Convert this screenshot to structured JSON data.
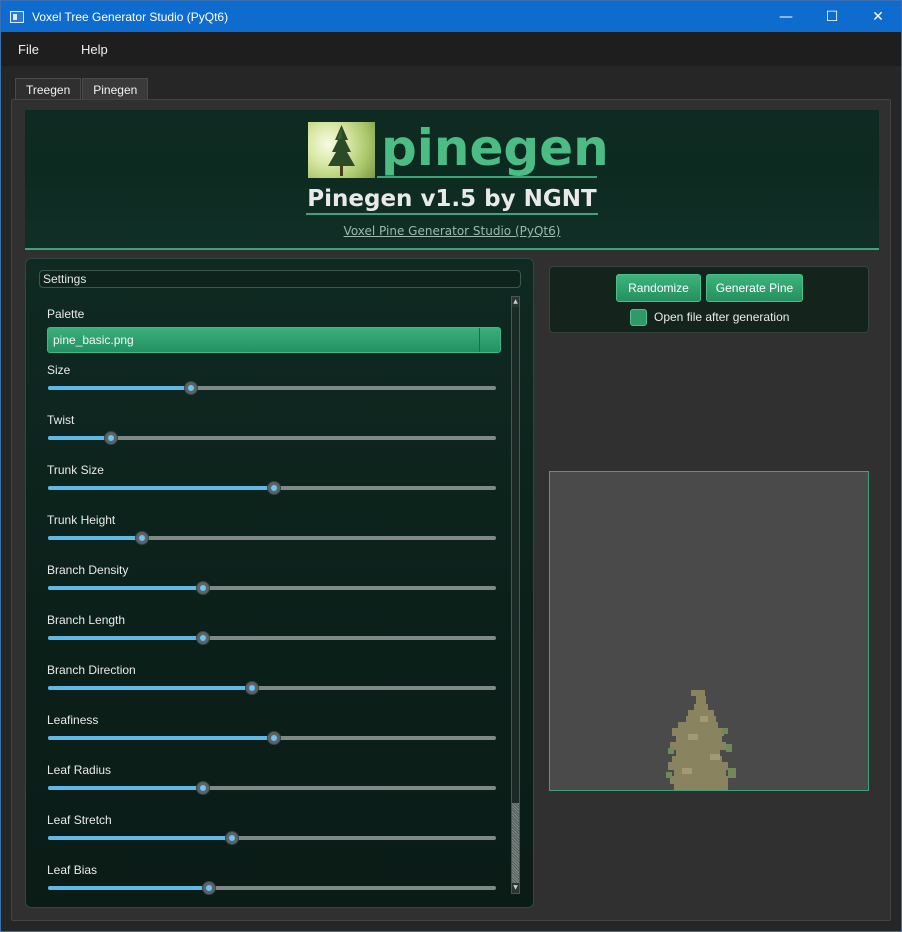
{
  "window": {
    "title": "Voxel Tree Generator Studio (PyQt6)",
    "minimize": "—",
    "maximize": "☐",
    "close": "✕"
  },
  "menu": {
    "file": "File",
    "help": "Help"
  },
  "tabs": [
    {
      "label": "Treegen"
    },
    {
      "label": "Pinegen"
    }
  ],
  "banner": {
    "logo_text": "pinegen",
    "title": "Pinegen v1.5 by NGNT",
    "subtitle": "Voxel Pine Generator Studio (PyQt6)"
  },
  "settings": {
    "header": "Settings",
    "palette_label": "Palette",
    "palette_value": "pine_basic.png",
    "sliders": [
      {
        "label": "Size",
        "value": 0.32
      },
      {
        "label": "Twist",
        "value": 0.14
      },
      {
        "label": "Trunk Size",
        "value": 0.505
      },
      {
        "label": "Trunk Height",
        "value": 0.21
      },
      {
        "label": "Branch Density",
        "value": 0.345
      },
      {
        "label": "Branch Length",
        "value": 0.345
      },
      {
        "label": "Branch Direction",
        "value": 0.455
      },
      {
        "label": "Leafiness",
        "value": 0.505
      },
      {
        "label": "Leaf Radius",
        "value": 0.345
      },
      {
        "label": "Leaf Stretch",
        "value": 0.41
      },
      {
        "label": "Leaf Bias",
        "value": 0.36
      }
    ]
  },
  "actions": {
    "randomize": "Randomize",
    "generate": "Generate Pine",
    "open_after": "Open file after generation",
    "open_after_checked": true
  },
  "colors": {
    "accent": "#3fa37a",
    "button": "#2f9d6b",
    "slider_fill": "#5fb8e6",
    "titlebar": "#0f6ccf"
  }
}
